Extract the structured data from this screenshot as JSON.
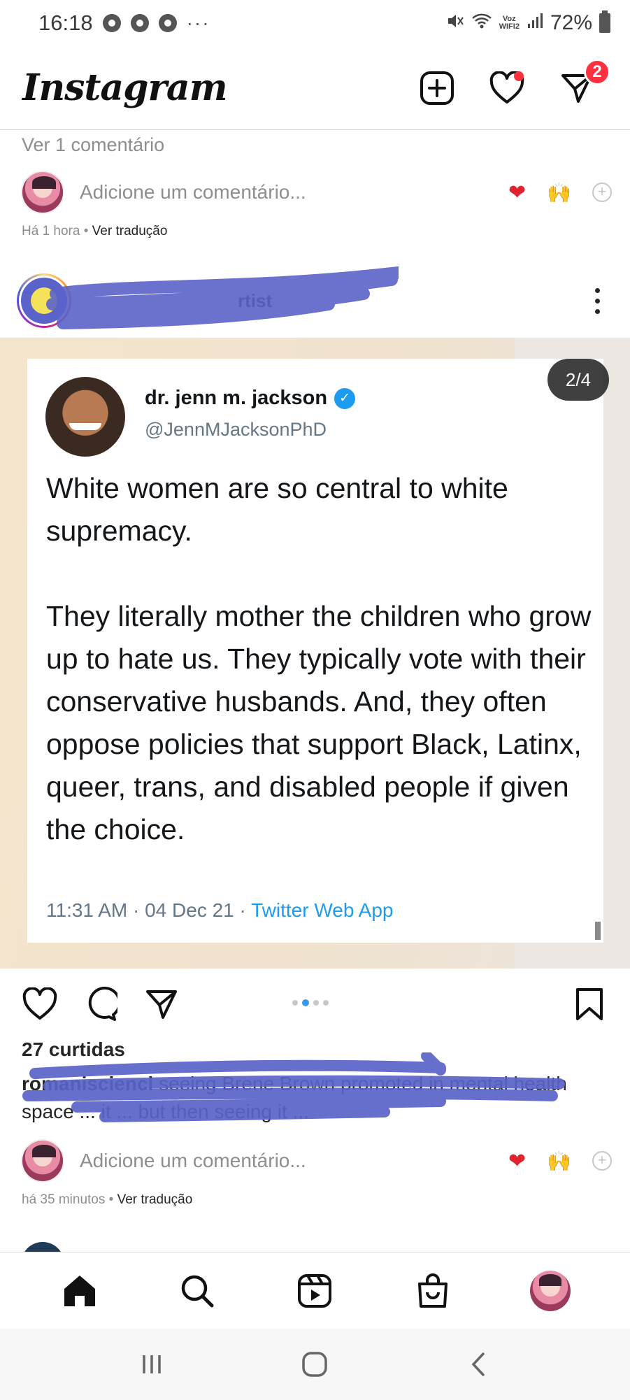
{
  "status_bar": {
    "time": "16:18",
    "more": "···",
    "voz_top": "Voz",
    "voz_bottom": "WIFI2",
    "battery": "72%"
  },
  "header": {
    "logo": "Instagram",
    "dm_badge": "2"
  },
  "previous_post": {
    "view_comments": "Ver 1 comentário",
    "comment_placeholder": "Adicione um comentário...",
    "time": "Há 1 hora",
    "separator": " • ",
    "translate": "Ver tradução"
  },
  "post": {
    "username_visible": "rtist",
    "slide_counter": "2/4",
    "tweet": {
      "name": "dr. jenn m. jackson",
      "handle": "@JennMJacksonPhD",
      "body": "White women are so central to white supremacy.\n\nThey literally mother the children who grow up to hate us. They typically vote with their conservative husbands. And, they often oppose policies that support Black, Latinx, queer, trans, and disabled people if given the choice.",
      "time": "11:31 AM · 04 Dec 21 · ",
      "source": "Twitter Web App"
    },
    "likes": "27 curtidas",
    "caption_user": "romanisciencl",
    "caption_text": " seeing Brene Brown promoted in mental health space ... it ... but then seeing it ... ",
    "comment_placeholder": "Adicione um comentário...",
    "time": "há 35 minutos",
    "separator": " • ",
    "translate": "Ver tradução",
    "carousel_total": 4,
    "carousel_active": 2
  },
  "colors": {
    "accent_red": "#ff3040",
    "link_blue": "#1d9bf0",
    "carousel_active": "#3897f0",
    "redaction": "#5a63c9"
  },
  "icons": {
    "header": [
      "new-post-icon",
      "activity-heart-icon",
      "direct-message-icon"
    ],
    "actions": [
      "like-icon",
      "comment-icon",
      "share-icon",
      "save-icon"
    ],
    "nav": [
      "home-icon",
      "search-icon",
      "reels-icon",
      "shop-icon",
      "profile-avatar"
    ],
    "system": [
      "recents-icon",
      "home-circle-icon",
      "back-icon"
    ]
  }
}
